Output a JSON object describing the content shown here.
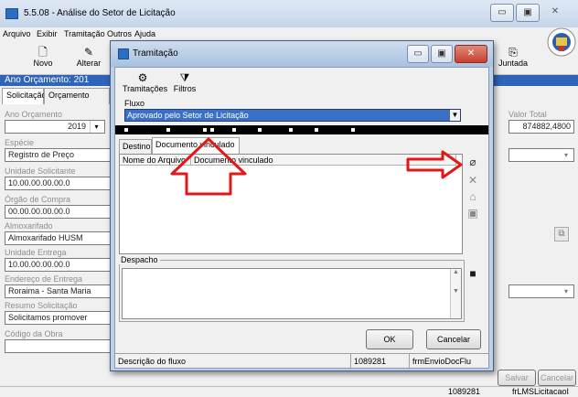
{
  "window": {
    "title": "5.5.08 - Análise do Setor de Licitação",
    "minimize": "▭",
    "maximize": "▣",
    "close": "✕"
  },
  "menu": [
    "Arquivo",
    "Exibir",
    "Tramitação",
    "Outros",
    "Ajuda"
  ],
  "toolbar": {
    "novo": "Novo",
    "alterar": "Alterar",
    "juntada": "Juntada"
  },
  "ano_header": "Ano Orçamento: 201",
  "tabs": [
    "Solicitação",
    "Orçamento"
  ],
  "form": {
    "ano_label": "Ano Orçamento",
    "ano_value": "2019",
    "especie_label": "Espécie",
    "especie_value": "Registro de Preço",
    "unidade_sol_label": "Unidade Solicitante",
    "unidade_sol_value": "10.00.00.00.00.0",
    "orgao_label": "Órgão de Compra",
    "orgao_value": "00.00.00.00.00.0",
    "almox_label": "Almoxarifado",
    "almox_value": "Almoxarifado HUSM",
    "unid_entrega_label": "Unidade Entrega",
    "unid_entrega_value": "10.00.00.00.00.0",
    "endereco_label": "Endereço de Entrega",
    "endereco_value": "Roraima - Santa Maria",
    "resumo_label": "Resumo Solicitação",
    "resumo_value": "Solicitamos promover",
    "codigo_label": "Código da Obra",
    "valor_total_label": "Valor Total",
    "valor_total_value": "874882,4800",
    "salvar": "Salvar",
    "cancelar": "Cancelar"
  },
  "main_status": {
    "id": "1089281",
    "form": "frLMSLicitacaoI"
  },
  "dialog": {
    "title": "Tramitação",
    "tramitacoes": "Tramitações",
    "filtros": "Filtros",
    "fluxo_label": "Fluxo",
    "fluxo_value": "Aprovado pelo Setor de Licitação",
    "tab_destino": "Destino",
    "tab_documento": "Documento vinculado",
    "col_nome": "Nome do Arquivo",
    "col_documento": "Documento vinculado",
    "despacho_label": "Despacho",
    "ok": "OK",
    "cancelar": "Cancelar",
    "status_desc": "Descrição do fluxo",
    "status_id": "1089281",
    "status_form": "frmEnvioDocFlu"
  },
  "colors": {
    "highlight": "#3a71c7",
    "arrow": "#e01818",
    "header_blue": "#2f64b8"
  },
  "icons": [
    "attach-icon",
    "delete-icon",
    "open-folder-icon",
    "save-icon",
    "gear-icon",
    "filter-icon"
  ]
}
